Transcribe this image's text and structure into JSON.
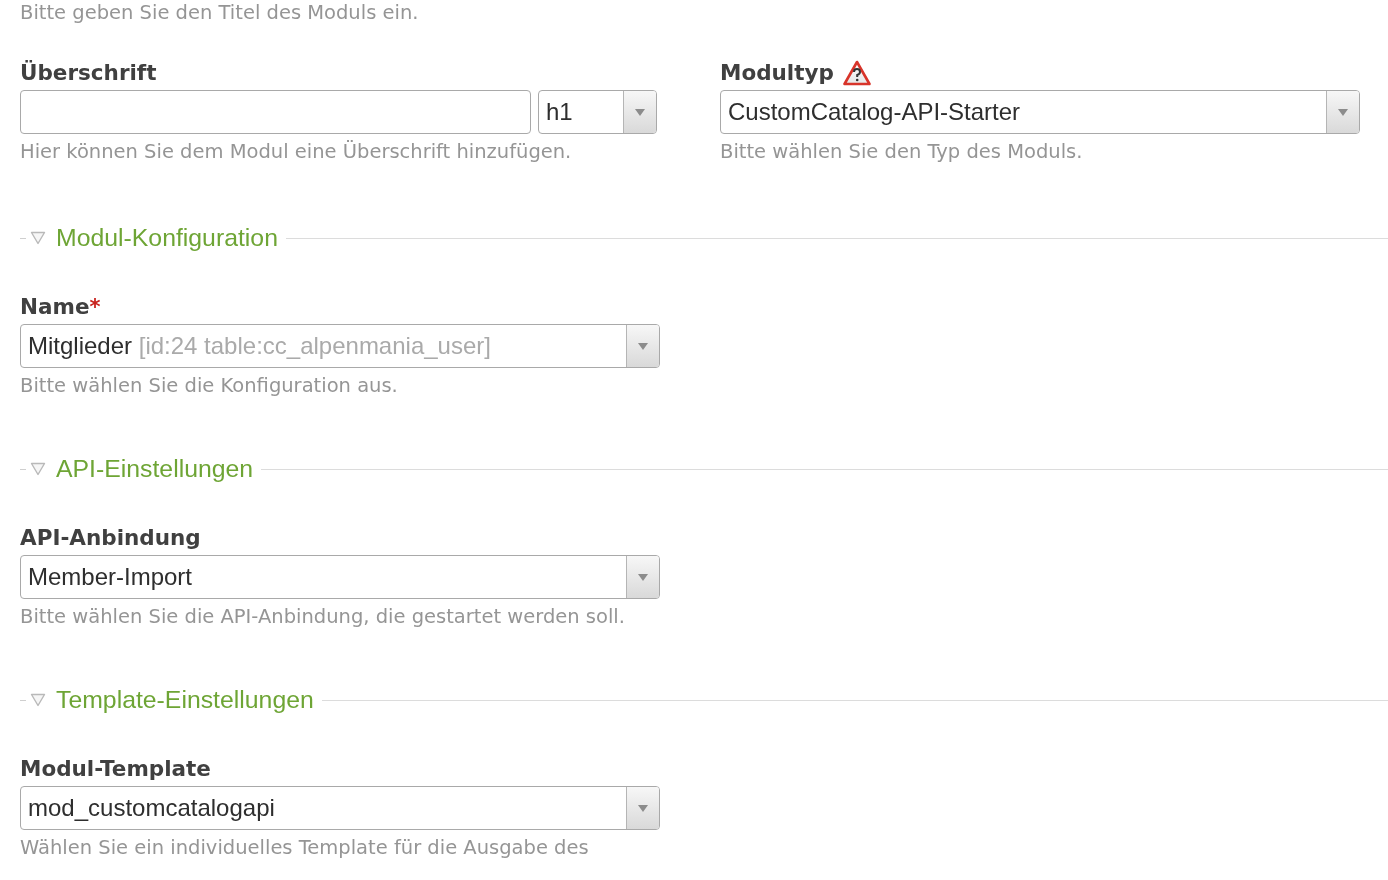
{
  "intro_hint": "Bitte geben Sie den Titel des Moduls ein.",
  "headline": {
    "label": "Überschrift",
    "level_select": {
      "value": "h1"
    },
    "hint": "Hier können Sie dem Modul eine Überschrift hinzufügen."
  },
  "module_type": {
    "label": "Modultyp",
    "warning": true,
    "value": "CustomCatalog-API-Starter",
    "hint": "Bitte wählen Sie den Typ des Moduls."
  },
  "sections": [
    {
      "title": "Modul-Konfiguration",
      "expanded": true,
      "fields": [
        {
          "label": "Name",
          "required_mark": "*",
          "value": "Mitglieder",
          "value_detail": "[id:24 table:cc_alpenmania_user]",
          "hint": "Bitte wählen Sie die Konfiguration aus."
        }
      ]
    },
    {
      "title": "API-Einstellungen",
      "expanded": true,
      "fields": [
        {
          "label": "API-Anbindung",
          "value": "Member-Import",
          "hint": "Bitte wählen Sie die API-Anbindung, die gestartet werden soll."
        }
      ]
    },
    {
      "title": "Template-Einstellungen",
      "expanded": true,
      "fields": [
        {
          "label": "Modul-Template",
          "value": "mod_customcatalogapi",
          "hint": "Wählen Sie ein individuelles Template für die Ausgabe des"
        }
      ]
    }
  ]
}
